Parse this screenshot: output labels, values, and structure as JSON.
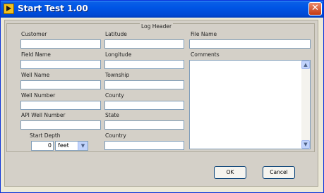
{
  "window": {
    "title": "Start Test  1.00"
  },
  "group_title": "Log Header",
  "fields": {
    "customer": {
      "label": "Customer",
      "value": ""
    },
    "field_name": {
      "label": "Field Name",
      "value": ""
    },
    "well_name": {
      "label": "Well Name",
      "value": ""
    },
    "well_number": {
      "label": "Well Number",
      "value": ""
    },
    "api_well_number": {
      "label": "API Well Number",
      "value": ""
    },
    "latitude": {
      "label": "Latitude",
      "value": ""
    },
    "longitude": {
      "label": "Longitude",
      "value": ""
    },
    "township": {
      "label": "Township",
      "value": ""
    },
    "county": {
      "label": "County",
      "value": ""
    },
    "state": {
      "label": "State",
      "value": ""
    },
    "country": {
      "label": "Country",
      "value": ""
    },
    "file_name": {
      "label": "File Name",
      "value": ""
    },
    "comments": {
      "label": "Comments",
      "value": ""
    }
  },
  "start_depth": {
    "label": "Start Depth",
    "value": "0",
    "unit": "feet"
  },
  "buttons": {
    "ok": "OK",
    "cancel": "Cancel"
  },
  "icons": {
    "app": "labview-run-icon",
    "close": "close-icon",
    "scroll_up": "chevron-up-icon",
    "scroll_down": "chevron-down-icon",
    "dropdown": "chevron-down-icon"
  }
}
